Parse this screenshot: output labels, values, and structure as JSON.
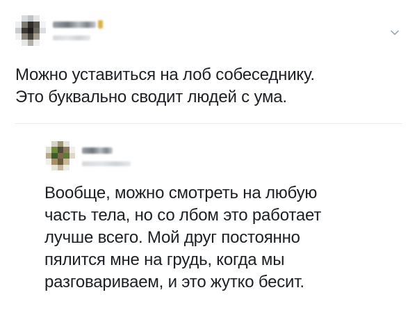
{
  "main_tweet": {
    "text_lines": [
      "Можно уставиться на лоб собеседнику.",
      "Это буквально сводит людей с ума."
    ]
  },
  "reply_tweet": {
    "text_lines": [
      "Вообще, можно смотреть на любую",
      "часть тела, но со лбом это работает",
      "лучше всего. Мой друг постоянно",
      "пялится мне на грудь, когда мы",
      "разговариваем, и это жутко бесит."
    ]
  },
  "icons": {
    "menu": "chevron-down-icon"
  },
  "colors": {
    "text": "#1c2024",
    "divider": "#e6ecf0",
    "chevron": "#8899a6"
  }
}
